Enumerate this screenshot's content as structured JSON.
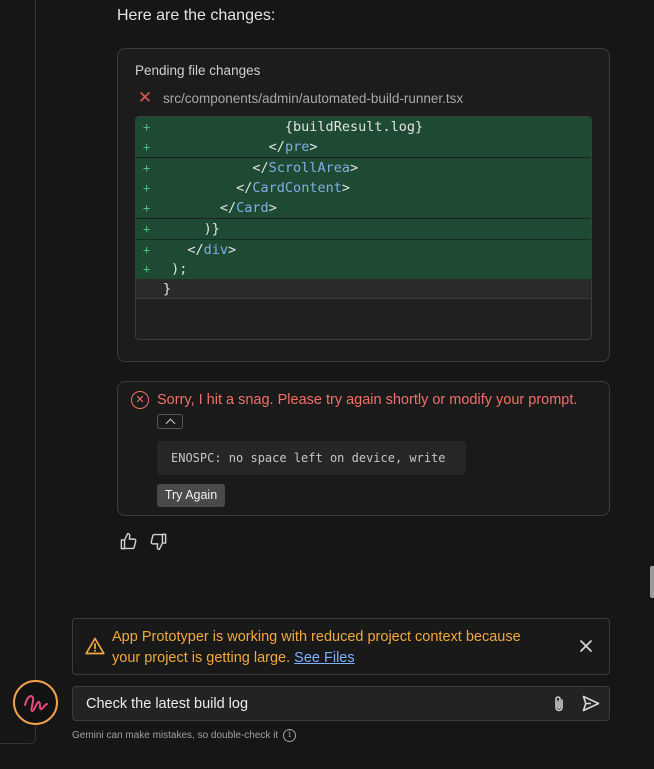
{
  "message": {
    "intro": "Here are the changes:"
  },
  "pending": {
    "title": "Pending file changes",
    "file_path": "src/components/admin/automated-build-runner.tsx",
    "diff_lines": [
      {
        "sign": "+",
        "indent": "               ",
        "open": "",
        "tag": "",
        "close": "",
        "text": "{buildResult.log}"
      },
      {
        "sign": "+",
        "indent": "             ",
        "open": "</",
        "tag": "pre",
        "close": ">",
        "text": ""
      },
      {
        "sign": "+",
        "indent": "           ",
        "open": "</",
        "tag": "ScrollArea",
        "close": ">",
        "text": ""
      },
      {
        "sign": "+",
        "indent": "         ",
        "open": "</",
        "tag": "CardContent",
        "close": ">",
        "text": ""
      },
      {
        "sign": "+",
        "indent": "       ",
        "open": "</",
        "tag": "Card",
        "close": ">",
        "text": ""
      },
      {
        "sign": "+",
        "indent": "     ",
        "open": "",
        "tag": "",
        "close": "",
        "text": ")}"
      },
      {
        "sign": "+",
        "indent": "   ",
        "open": "</",
        "tag": "div",
        "close": ">",
        "text": ""
      },
      {
        "sign": "+",
        "indent": " ",
        "open": "",
        "tag": "",
        "close": "",
        "text": ");"
      },
      {
        "sign": "",
        "indent": "",
        "open": "",
        "tag": "",
        "close": "",
        "text": "}"
      }
    ]
  },
  "error": {
    "message": "Sorry, I hit a snag. Please try again shortly or modify your prompt.",
    "detail": "ENOSPC: no space left on device, write",
    "retry_label": "Try Again"
  },
  "feedback": {
    "up_icon": "thumbs-up-icon",
    "down_icon": "thumbs-down-icon"
  },
  "warning": {
    "text": "App Prototyper is working with reduced project context because your project is getting large.",
    "link_label": "See Files"
  },
  "prompt": {
    "value": "Check the latest build log"
  },
  "disclaimer": {
    "text": "Gemini can make mistakes, so double-check it"
  },
  "colors": {
    "background": "#161616",
    "error": "#f07167",
    "warning": "#f2a93b",
    "diff_added_bg": "#1e4a33",
    "code_tag": "#7faee8",
    "avatar_accent": "#f0a24e",
    "link": "#7fb0ff"
  }
}
